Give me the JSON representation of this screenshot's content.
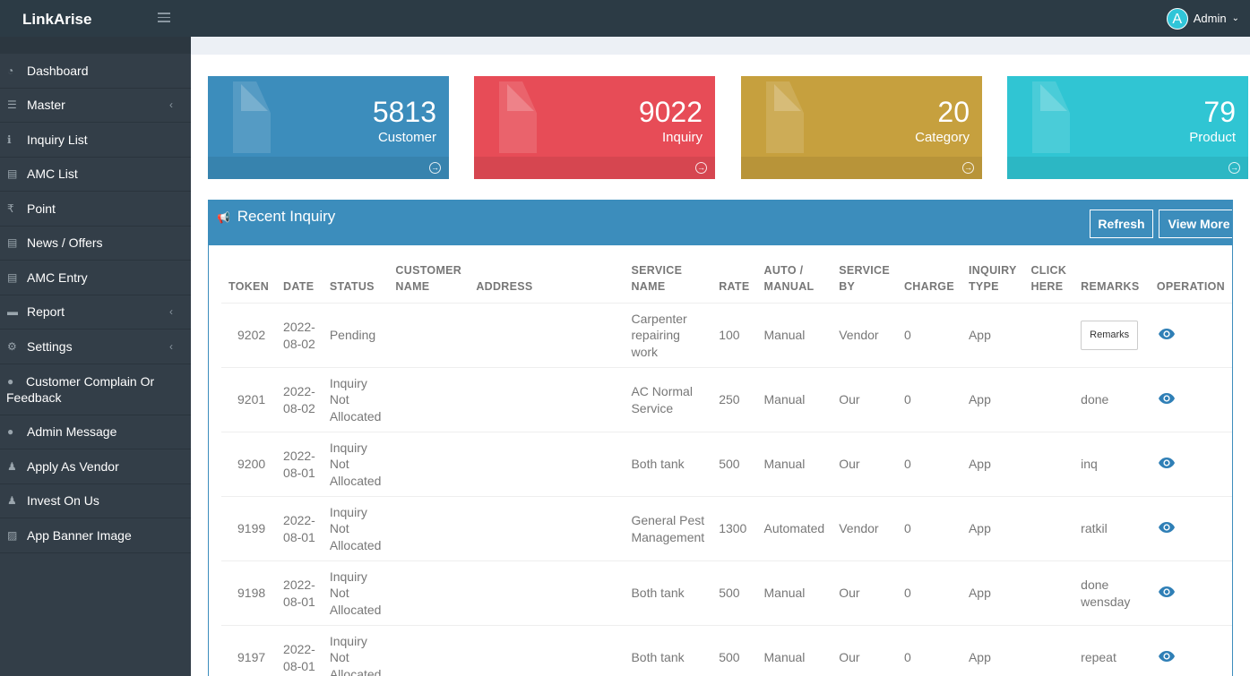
{
  "header": {
    "brand": "LinkArise",
    "user": "Admin",
    "avatar_letter": "A"
  },
  "sidebar": {
    "items": [
      {
        "label": "Dashboard",
        "icon": "dashboard-icon",
        "glyph": "◔",
        "chevron": false
      },
      {
        "label": "Master",
        "icon": "list-icon",
        "glyph": "☰",
        "chevron": true
      },
      {
        "label": "Inquiry List",
        "icon": "info-icon",
        "glyph": "ℹ",
        "chevron": false
      },
      {
        "label": "AMC List",
        "icon": "card-icon",
        "glyph": "▤",
        "chevron": false
      },
      {
        "label": "Point",
        "icon": "rupee-icon",
        "glyph": "₹",
        "chevron": false
      },
      {
        "label": "News / Offers",
        "icon": "newspaper-icon",
        "glyph": "▤",
        "chevron": false
      },
      {
        "label": "AMC Entry",
        "icon": "card-icon",
        "glyph": "▤",
        "chevron": false
      },
      {
        "label": "Report",
        "icon": "report-icon",
        "glyph": "▬",
        "chevron": true
      },
      {
        "label": "Settings",
        "icon": "gear-icon",
        "glyph": "⚙",
        "chevron": true
      },
      {
        "label": "Customer Complain Or Feedback",
        "icon": "comment-icon",
        "glyph": "●",
        "chevron": false,
        "multi": true
      },
      {
        "label": "Admin Message",
        "icon": "comment-icon",
        "glyph": "●",
        "chevron": false
      },
      {
        "label": "Apply As Vendor",
        "icon": "user-icon",
        "glyph": "♟",
        "chevron": false
      },
      {
        "label": "Invest On Us",
        "icon": "user-icon",
        "glyph": "♟",
        "chevron": false
      },
      {
        "label": "App Banner Image",
        "icon": "image-icon",
        "glyph": "▨",
        "chevron": false
      }
    ]
  },
  "tiles": [
    {
      "value": "5813",
      "label": "Customer",
      "color": "#3c8dbc"
    },
    {
      "value": "9022",
      "label": "Inquiry",
      "color": "#e74c57"
    },
    {
      "value": "20",
      "label": "Category",
      "color": "#c6a03e"
    },
    {
      "value": "79",
      "label": "Product",
      "color": "#30c5d3"
    }
  ],
  "panel": {
    "title": "Recent Inquiry",
    "refresh_label": "Refresh",
    "view_more_label": "View More",
    "columns": [
      "TOKEN",
      "DATE",
      "STATUS",
      "CUSTOMER NAME",
      "ADDRESS",
      "SERVICE NAME",
      "RATE",
      "AUTO / MANUAL",
      "SERVICE BY",
      "CHARGE",
      "INQUIRY TYPE",
      "CLICK HERE",
      "REMARKS",
      "OPERATION"
    ],
    "remarks_button": "Remarks",
    "rows": [
      {
        "token": "9202",
        "date": "2022-08-02",
        "status": "Pending",
        "service": "Carpenter repairing work",
        "rate": "100",
        "mode": "Manual",
        "by": "Vendor",
        "charge": "0",
        "type": "App",
        "remarks": ""
      },
      {
        "token": "9201",
        "date": "2022-08-02",
        "status": "Inquiry Not Allocated",
        "service": "AC Normal Service",
        "rate": "250",
        "mode": "Manual",
        "by": "Our",
        "charge": "0",
        "type": "App",
        "remarks": "done"
      },
      {
        "token": "9200",
        "date": "2022-08-01",
        "status": "Inquiry Not Allocated",
        "service": "Both tank",
        "rate": "500",
        "mode": "Manual",
        "by": "Our",
        "charge": "0",
        "type": "App",
        "remarks": "inq"
      },
      {
        "token": "9199",
        "date": "2022-08-01",
        "status": "Inquiry Not Allocated",
        "service": "General Pest Management",
        "rate": "1300",
        "mode": "Automated",
        "by": "Vendor",
        "charge": "0",
        "type": "App",
        "remarks": "ratkil"
      },
      {
        "token": "9198",
        "date": "2022-08-01",
        "status": "Inquiry Not Allocated",
        "service": "Both tank",
        "rate": "500",
        "mode": "Manual",
        "by": "Our",
        "charge": "0",
        "type": "App",
        "remarks": "done wensday"
      },
      {
        "token": "9197",
        "date": "2022-08-01",
        "status": "Inquiry Not Allocated",
        "service": "Both tank",
        "rate": "500",
        "mode": "Manual",
        "by": "Our",
        "charge": "0",
        "type": "App",
        "remarks": "repeat"
      }
    ]
  }
}
